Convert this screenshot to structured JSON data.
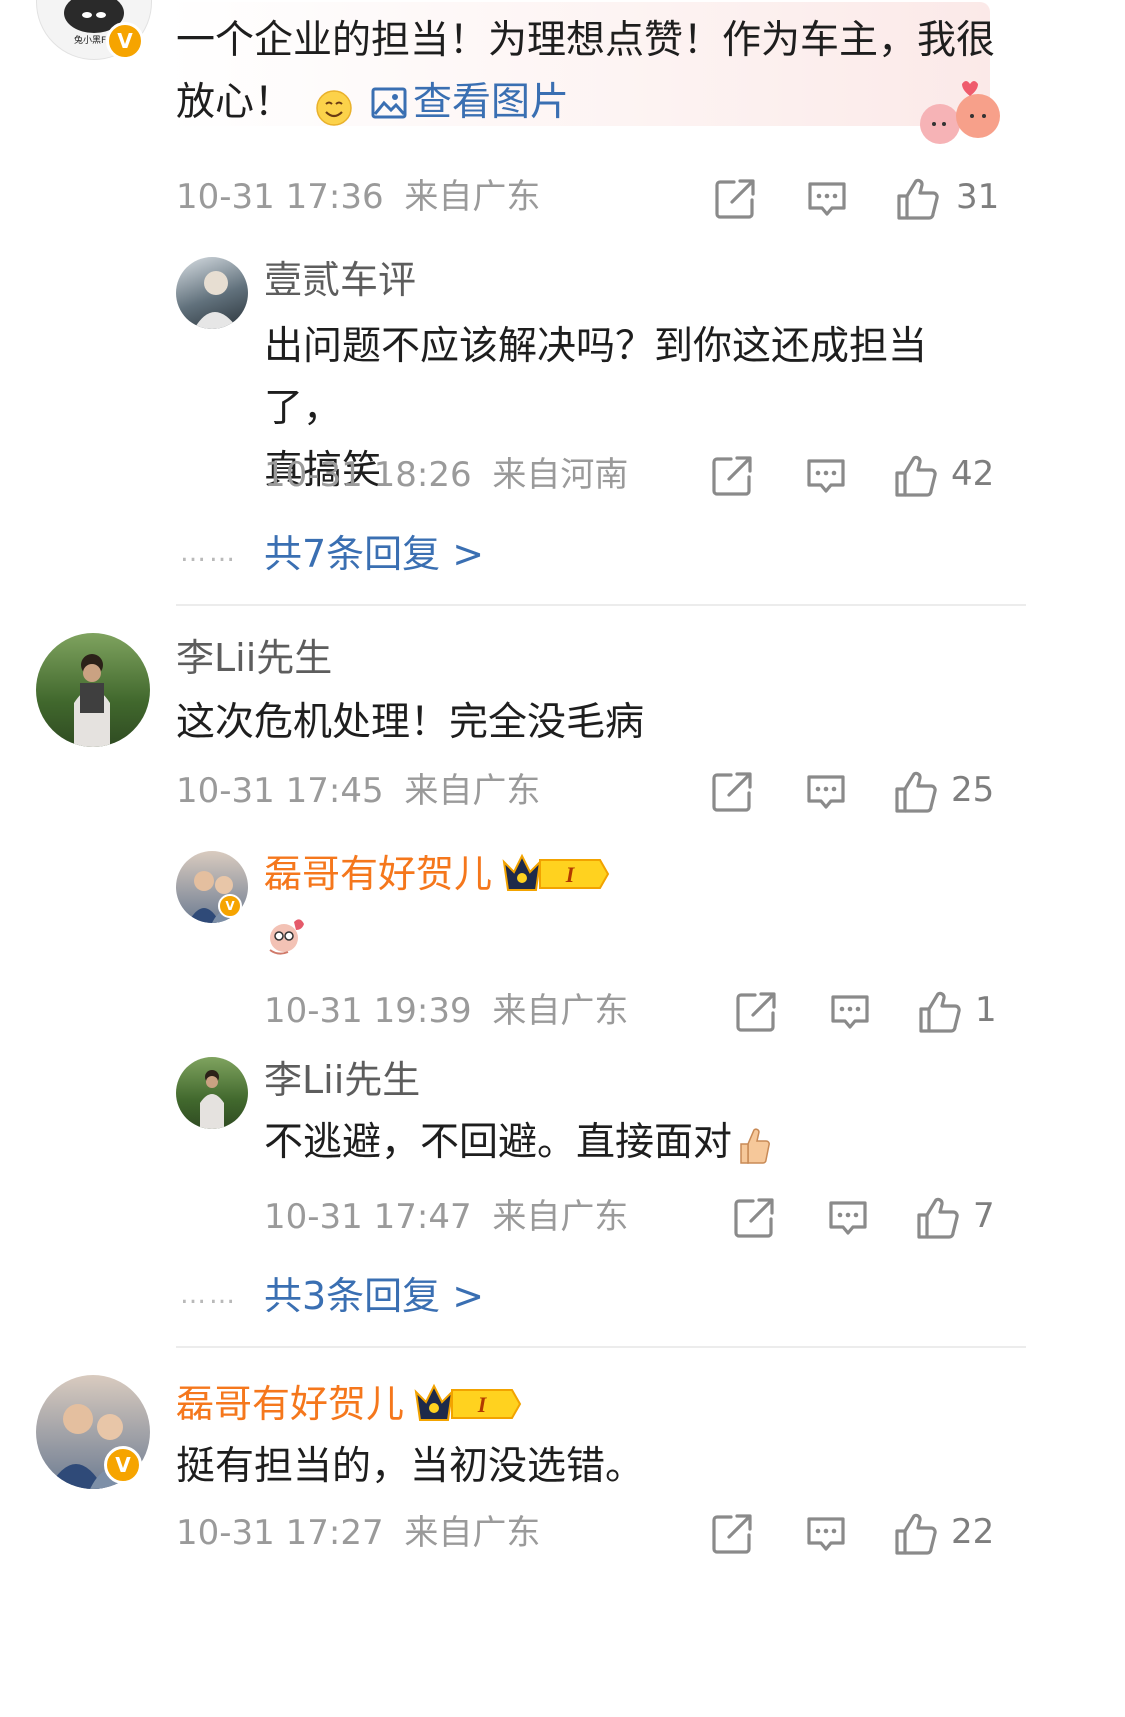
{
  "comments": [
    {
      "user": "兔小黑Fly",
      "text_line1": "一个企业的担当！为理想点赞！作为车主，我很",
      "text_line2": "放心！",
      "emoji": "smile-emoji",
      "view_image_label": "查看图片",
      "time": "10-31 17:36",
      "location": "来自广东",
      "likes": "31",
      "replies": [
        {
          "user": "壹贰车评",
          "text_line1": "出问题不应该解决吗？到你这还成担当了，",
          "text_line2": "真搞笑",
          "time": "10-31 18:26",
          "location": "来自河南",
          "likes": "42"
        }
      ],
      "more_replies": "共7条回复 >"
    },
    {
      "user": "李Lii先生",
      "text": "这次危机处理！完全没毛病",
      "time": "10-31 17:45",
      "location": "来自广东",
      "likes": "25",
      "replies": [
        {
          "user": "磊哥有好贺儿",
          "badge_level": "I",
          "emoji": "sticker-emoji",
          "time": "10-31 19:39",
          "location": "来自广东",
          "likes": "1"
        },
        {
          "user": "李Lii先生",
          "text": "不逃避，不回避。直接面对",
          "emoji": "thumbs-up-emoji",
          "time": "10-31 17:47",
          "location": "来自广东",
          "likes": "7"
        }
      ],
      "more_replies": "共3条回复 >"
    },
    {
      "user": "磊哥有好贺儿",
      "badge_level": "I",
      "text": "挺有担当的，当初没选错。",
      "time": "10-31 17:27",
      "location": "来自广东",
      "likes": "22"
    }
  ],
  "dots": "……",
  "colors": {
    "accent_link": "#3a6fb2",
    "vip_name": "#f5771c",
    "meta_gray": "#9a9a9a",
    "verified_badge": "#f6a400"
  },
  "icons": [
    "share-icon",
    "comment-icon",
    "like-icon",
    "verified-badge-icon",
    "crown-icon",
    "image-icon"
  ]
}
